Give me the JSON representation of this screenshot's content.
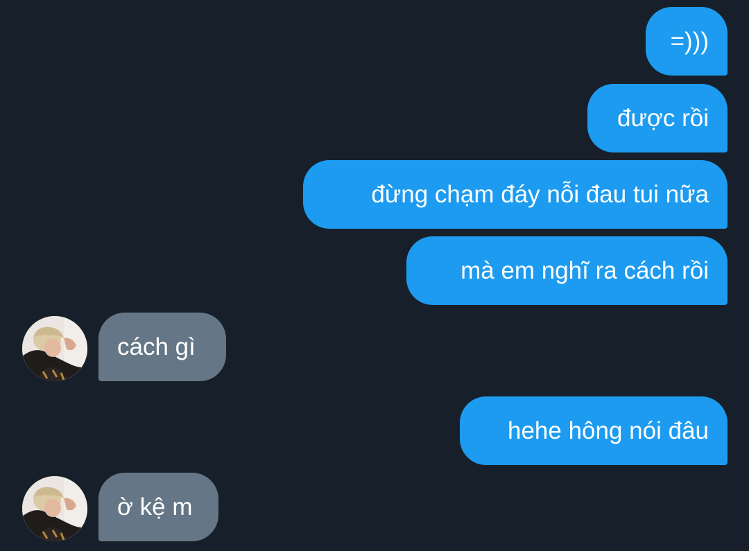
{
  "messages": [
    {
      "direction": "outgoing",
      "text": "=)))"
    },
    {
      "direction": "outgoing",
      "text": "được rồi"
    },
    {
      "direction": "outgoing",
      "text": "đừng chạm đáy nỗi đau tui nữa"
    },
    {
      "direction": "outgoing",
      "text": "mà em nghĩ ra cách rồi"
    },
    {
      "direction": "incoming",
      "text": "cách gì"
    },
    {
      "direction": "outgoing",
      "text": "hehe hông nói đâu"
    },
    {
      "direction": "incoming",
      "text": "ờ kệ m"
    }
  ],
  "colors": {
    "background": "#17202a",
    "outgoing_bubble": "#1d9bf0",
    "incoming_bubble": "#657686",
    "text": "#ffffff"
  },
  "icons": {
    "avatar": "contact-avatar-photo"
  }
}
